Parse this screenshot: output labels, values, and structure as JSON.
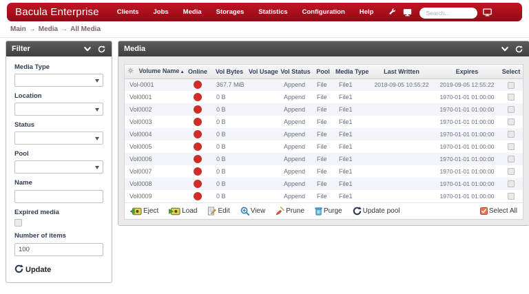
{
  "navbar": {
    "brand": "Bacula Enterprise",
    "items": [
      "Clients",
      "Jobs",
      "Media",
      "Storages",
      "Statistics",
      "Configuration",
      "Help"
    ],
    "search_placeholder": "Search...",
    "icons": [
      "wrench-icon",
      "console-icon",
      "monitor-icon"
    ],
    "colors": {
      "bg": "#a80f1c"
    }
  },
  "breadcrumb": {
    "items": [
      "Main",
      "Media",
      "All Media"
    ],
    "separator": "→"
  },
  "filter_panel": {
    "title": "Filter",
    "header_icons": [
      "chevron-down-icon",
      "refresh-icon"
    ],
    "fields": [
      {
        "label": "Media Type",
        "type": "select",
        "value": ""
      },
      {
        "label": "Location",
        "type": "select",
        "value": ""
      },
      {
        "label": "Status",
        "type": "select",
        "value": ""
      },
      {
        "label": "Pool",
        "type": "select",
        "value": ""
      },
      {
        "label": "Name",
        "type": "text",
        "value": ""
      },
      {
        "label": "Expired media",
        "type": "checkbox",
        "checked": false
      },
      {
        "label": "Number of items",
        "type": "text",
        "value": "100"
      }
    ],
    "update_label": "Update"
  },
  "media_panel": {
    "title": "Media",
    "header_icons": [
      "chevron-down-icon",
      "refresh-icon"
    ],
    "table": {
      "columns": [
        "Volume Name",
        "Online",
        "Vol Bytes",
        "Vol Usage",
        "Vol Status",
        "Pool",
        "Media Type",
        "Last Written",
        "Expires",
        "Select"
      ],
      "sort_column": "Volume Name",
      "sort_arrow": "▲",
      "rows": [
        {
          "volume_name": "Vol-0001",
          "online": true,
          "vol_bytes": "367.7 MiB",
          "vol_usage": "",
          "vol_status": "Append",
          "pool": "File",
          "media_type": "File1",
          "last_written": "2018-09-05 10:55:22",
          "expires": "2019-09-05 12:55:22",
          "selected": false
        },
        {
          "volume_name": "Vol0001",
          "online": true,
          "vol_bytes": "0 B",
          "vol_usage": "",
          "vol_status": "Append",
          "pool": "File",
          "media_type": "File1",
          "last_written": "",
          "expires": "1970-01-01 01:00:00",
          "selected": false
        },
        {
          "volume_name": "Vol0002",
          "online": true,
          "vol_bytes": "0 B",
          "vol_usage": "",
          "vol_status": "Append",
          "pool": "File",
          "media_type": "File1",
          "last_written": "",
          "expires": "1970-01-01 01:00:00",
          "selected": false
        },
        {
          "volume_name": "Vol0003",
          "online": true,
          "vol_bytes": "0 B",
          "vol_usage": "",
          "vol_status": "Append",
          "pool": "File",
          "media_type": "File1",
          "last_written": "",
          "expires": "1970-01-01 01:00:00",
          "selected": false
        },
        {
          "volume_name": "Vol0004",
          "online": true,
          "vol_bytes": "0 B",
          "vol_usage": "",
          "vol_status": "Append",
          "pool": "File",
          "media_type": "File1",
          "last_written": "",
          "expires": "1970-01-01 01:00:00",
          "selected": false
        },
        {
          "volume_name": "Vol0005",
          "online": true,
          "vol_bytes": "0 B",
          "vol_usage": "",
          "vol_status": "Append",
          "pool": "File",
          "media_type": "File1",
          "last_written": "",
          "expires": "1970-01-01 01:00:00",
          "selected": false
        },
        {
          "volume_name": "Vol0006",
          "online": true,
          "vol_bytes": "0 B",
          "vol_usage": "",
          "vol_status": "Append",
          "pool": "File",
          "media_type": "File1",
          "last_written": "",
          "expires": "1970-01-01 01:00:00",
          "selected": false
        },
        {
          "volume_name": "Vol0007",
          "online": true,
          "vol_bytes": "0 B",
          "vol_usage": "",
          "vol_status": "Append",
          "pool": "File",
          "media_type": "File1",
          "last_written": "",
          "expires": "1970-01-01 01:00:00",
          "selected": false
        },
        {
          "volume_name": "Vol0008",
          "online": true,
          "vol_bytes": "0 B",
          "vol_usage": "",
          "vol_status": "Append",
          "pool": "File",
          "media_type": "File1",
          "last_written": "",
          "expires": "1970-01-01 01:00:00",
          "selected": false
        },
        {
          "volume_name": "Vol0009",
          "online": true,
          "vol_bytes": "0 B",
          "vol_usage": "",
          "vol_status": "Append",
          "pool": "File",
          "media_type": "File1",
          "last_written": "",
          "expires": "1970-01-01 01:00:00",
          "selected": false
        }
      ]
    },
    "toolbar": {
      "buttons": [
        {
          "label": "Eject",
          "icon": "eject-tape-icon"
        },
        {
          "label": "Load",
          "icon": "load-tape-icon"
        },
        {
          "label": "Edit",
          "icon": "edit-document-icon"
        },
        {
          "label": "View",
          "icon": "magnifier-plus-icon"
        },
        {
          "label": "Prune",
          "icon": "broom-icon"
        },
        {
          "label": "Purge",
          "icon": "trash-icon"
        },
        {
          "label": "Update pool",
          "icon": "refresh-icon"
        }
      ],
      "select_all_label": "Select All",
      "select_all_icon": "checked-box-icon"
    }
  },
  "colors": {
    "navbar_red": "#a80f1c",
    "panel_header_gray": "#4c4c4c",
    "online_dot_red": "#cb2f28",
    "select_all_orange": "#e8714f",
    "row_alt": "#f3f5fa"
  }
}
